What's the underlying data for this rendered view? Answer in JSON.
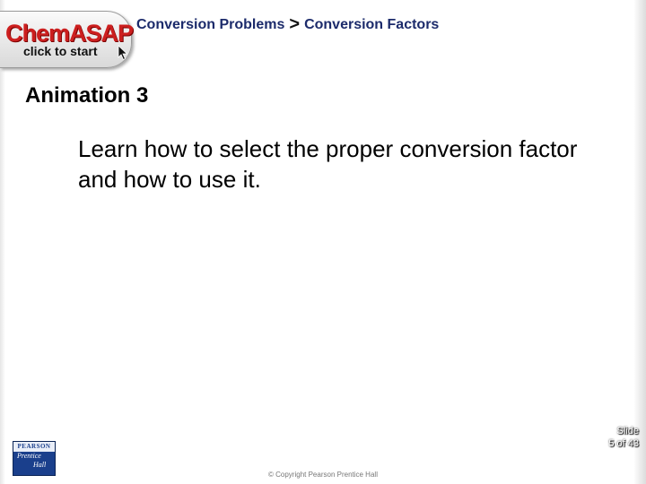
{
  "launcher": {
    "logo_text": "ChemASAP",
    "sub_text": "click to start"
  },
  "breadcrumb": {
    "section": "Conversion Problems",
    "separator": ">",
    "topic": "Conversion Factors"
  },
  "slide": {
    "title": "Animation 3",
    "body": "Learn how to select the proper conversion factor and how to use it."
  },
  "footer": {
    "slide_label": "Slide",
    "slide_position": "5 of 43",
    "copyright": "© Copyright Pearson Prentice Hall",
    "publisher_word": "PEARSON",
    "publisher_line1": "Prentice",
    "publisher_line2": "Hall"
  },
  "colors": {
    "logo_red": "#cc1f1f",
    "breadcrumb_navy": "#1c2b6b",
    "publisher_blue": "#1a3f8c"
  }
}
